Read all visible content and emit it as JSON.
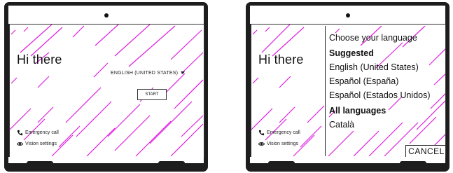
{
  "home_screen": {
    "greeting": "Hi there",
    "language_selector": "ENGLISH (UNITED STATES)",
    "start_button": "START",
    "emergency_call": "Emergency call",
    "vision_settings": "Vision settings"
  },
  "language_screen": {
    "greeting": "Hi there",
    "emergency_call": "Emergency call",
    "vision_settings": "Vision settings",
    "title": "Choose your language",
    "suggested_heading": "Suggested",
    "suggested": [
      "English (United States)",
      "Español (España)",
      "Español (Estados Unidos)"
    ],
    "all_heading": "All languages",
    "all": [
      "Català"
    ],
    "cancel_button": "CANCEL"
  },
  "colors": {
    "marks": "#e020e0",
    "bezel": "#1d1d1d"
  },
  "icons": [
    "phone-icon",
    "eye-icon",
    "caret-down-icon"
  ]
}
